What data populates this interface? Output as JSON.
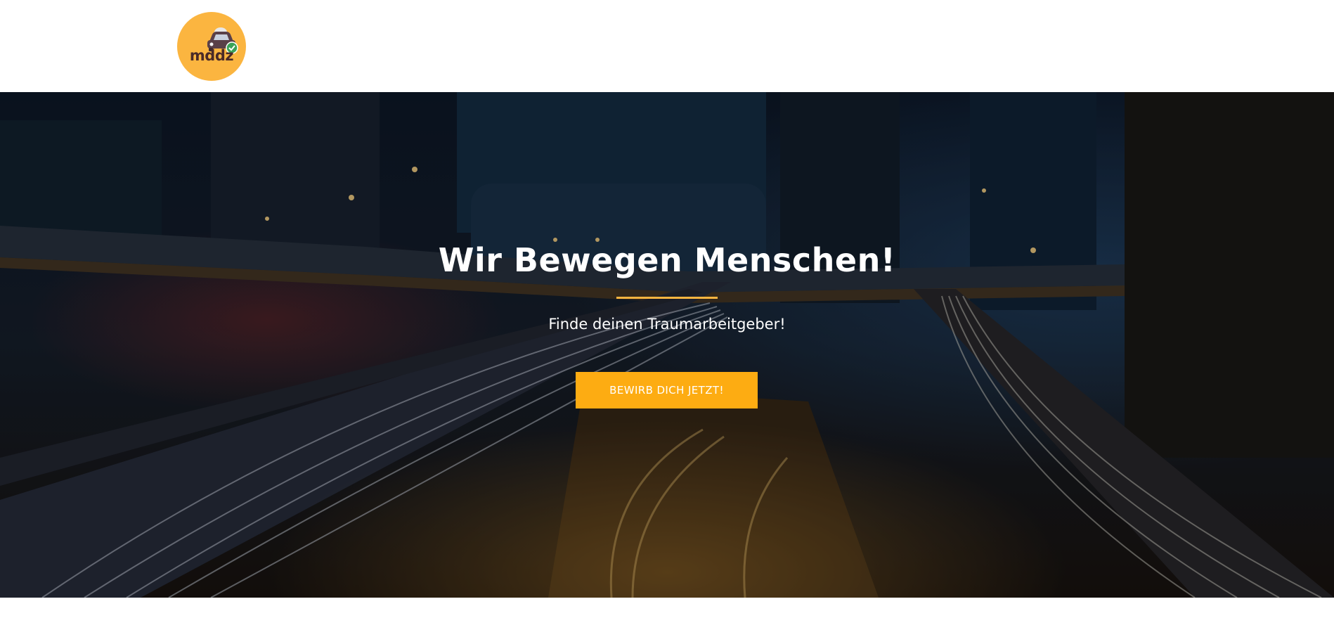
{
  "brand": {
    "logo_text": "mddz",
    "logo_icon": "car-check-icon",
    "logo_color": "#fbb540"
  },
  "hero": {
    "background": "night-city-traffic-light-trails-photo",
    "title": "Wir Bewegen Menschen!",
    "subtitle": "Finde deinen Traumarbeitgeber!",
    "cta_label": "Bewirb dich jetzt!",
    "accent_color": "#fdac12",
    "overlay_color": "#000000"
  }
}
